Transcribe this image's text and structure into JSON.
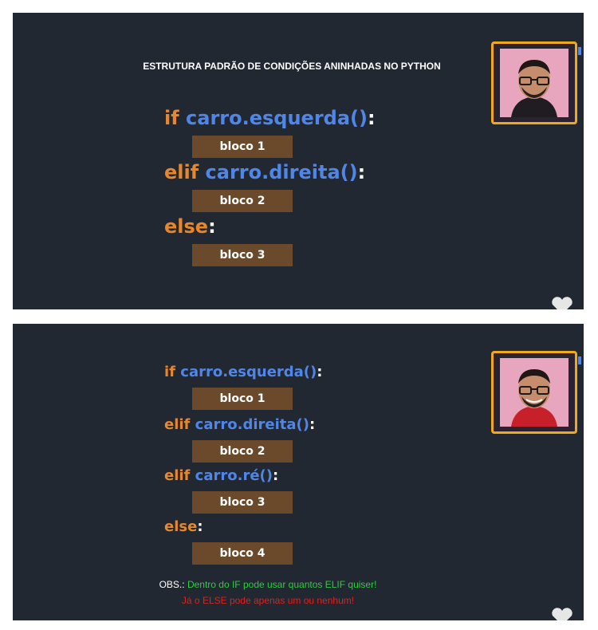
{
  "slide1": {
    "title": "ESTRUTURA PADRÃO DE CONDIÇÕES ANINHADAS NO PYTHON",
    "lines": [
      {
        "kw": "if",
        "expr": "carro.esquerda()",
        "colon": ":"
      },
      {
        "block": "bloco 1"
      },
      {
        "kw": "elif",
        "expr": "carro.direita()",
        "colon": ":"
      },
      {
        "block": "bloco 2"
      },
      {
        "kw": "else",
        "colon": ":"
      },
      {
        "block": "bloco 3"
      }
    ]
  },
  "slide2": {
    "lines": [
      {
        "kw": "if",
        "expr": "carro.esquerda()",
        "colon": ":"
      },
      {
        "block": "bloco 1"
      },
      {
        "kw": "elif",
        "expr": "carro.direita()",
        "colon": ":"
      },
      {
        "block": "bloco 2"
      },
      {
        "kw": "elif",
        "expr": "carro.ré()",
        "colon": ":"
      },
      {
        "block": "bloco 3"
      },
      {
        "kw": "else",
        "colon": ":"
      },
      {
        "block": "bloco 4"
      }
    ],
    "obs_label": "OBS.:",
    "obs_green": "Dentro do IF pode usar quantos ELIF quiser!",
    "obs_red": "Já o ELSE pode apenas um ou nenhum!"
  },
  "colors": {
    "background": "#222831",
    "keyword": "#e8872a",
    "function": "#4f86e8",
    "block": "#6b4a2b",
    "webcam_border": "#f2a81d",
    "obs_green": "#2ecc40",
    "obs_red": "#e0201c"
  },
  "icons": [
    "webcam-thumbnail",
    "heart-icon"
  ]
}
